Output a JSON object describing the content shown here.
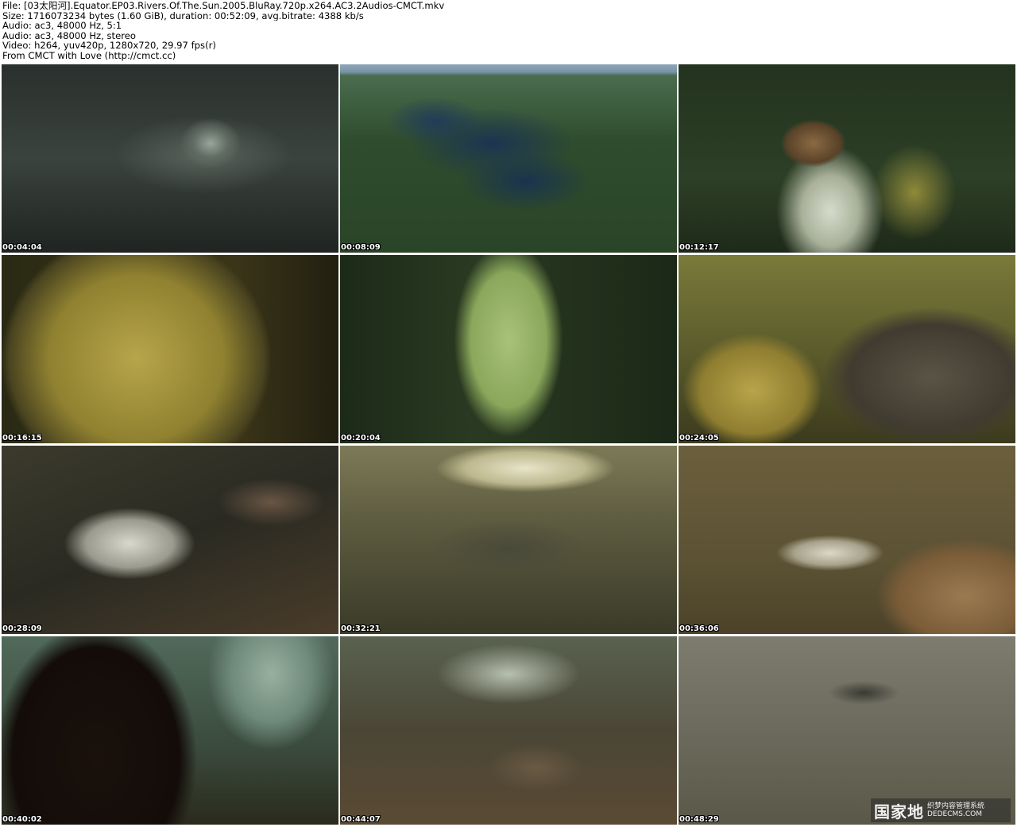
{
  "header": {
    "lines": [
      "File: [03太阳河].Equator.EP03.Rivers.Of.The.Sun.2005.BluRay.720p.x264.AC3.2Audios-CMCT.mkv",
      "Size: 1716073234 bytes (1.60 GiB), duration: 00:52:09, avg.bitrate: 4388 kb/s",
      "Audio: ac3, 48000 Hz, 5:1",
      "Audio: ac3, 48000 Hz, stereo",
      "Video: h264, yuv420p, 1280x720, 29.97 fps(r)",
      "From CMCT with Love (http://cmct.cc)"
    ]
  },
  "thumbnails": [
    {
      "timestamp": "00:04:04"
    },
    {
      "timestamp": "00:08:09"
    },
    {
      "timestamp": "00:12:17"
    },
    {
      "timestamp": "00:16:15"
    },
    {
      "timestamp": "00:20:04"
    },
    {
      "timestamp": "00:24:05"
    },
    {
      "timestamp": "00:28:09"
    },
    {
      "timestamp": "00:32:21"
    },
    {
      "timestamp": "00:36:06"
    },
    {
      "timestamp": "00:40:02"
    },
    {
      "timestamp": "00:44:07"
    },
    {
      "timestamp": "00:48:29"
    }
  ],
  "watermark": {
    "logo_text": "国家地",
    "line1": "织梦内容管理系统",
    "line2": "DEDECMS.COM"
  }
}
